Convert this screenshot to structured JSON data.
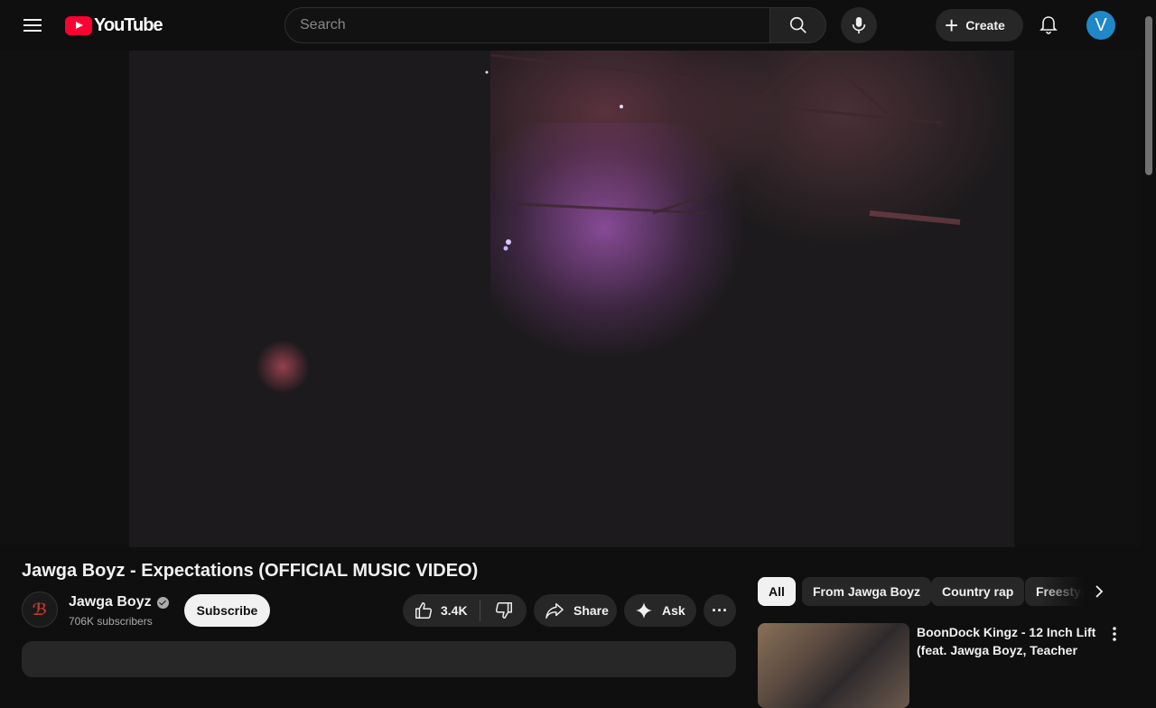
{
  "header": {
    "logo_text": "YouTube",
    "search_placeholder": "Search",
    "create_label": "Create",
    "avatar_letter": "V"
  },
  "video": {
    "title": "Jawga Boyz - Expectations (OFFICIAL MUSIC VIDEO)"
  },
  "channel": {
    "name": "Jawga Boyz",
    "subscribers": "706K subscribers",
    "subscribe_label": "Subscribe"
  },
  "actions": {
    "like_count": "3.4K",
    "share_label": "Share",
    "ask_label": "Ask",
    "more_label": "···"
  },
  "chips": [
    {
      "label": "All",
      "active": true
    },
    {
      "label": "From Jawga Boyz",
      "active": false
    },
    {
      "label": "Country rap",
      "active": false
    },
    {
      "label": "Freestyle",
      "active": false
    }
  ],
  "recommendations": [
    {
      "title": "BoonDock Kingz - 12 Inch Lift (feat. Jawga Boyz, Teacher"
    }
  ],
  "colors": {
    "background": "#0f0f0f",
    "accent_red": "#ff0033",
    "avatar_blue": "#1e88c8"
  }
}
